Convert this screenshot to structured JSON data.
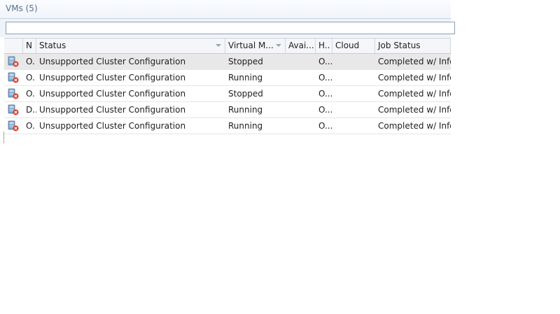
{
  "panel": {
    "title": "VMs (5)",
    "filter": {
      "value": "",
      "placeholder": ""
    }
  },
  "grid": {
    "columns": [
      {
        "key": "icon",
        "label": ""
      },
      {
        "key": "name",
        "label": "N"
      },
      {
        "key": "status",
        "label": "Status"
      },
      {
        "key": "vm",
        "label": "Virtual M..."
      },
      {
        "key": "avail",
        "label": "Avai..."
      },
      {
        "key": "host",
        "label": "H.."
      },
      {
        "key": "cloud",
        "label": "Cloud"
      },
      {
        "key": "job",
        "label": "Job Status"
      }
    ],
    "rows": [
      {
        "icon": "vm-error-icon",
        "name": "O.",
        "status": "Unsupported Cluster Configuration",
        "vm": "Stopped",
        "avail": "",
        "host": "O...",
        "cloud": "",
        "job": "Completed w/ Info",
        "selected": true
      },
      {
        "icon": "vm-error-icon",
        "name": "O.",
        "status": "Unsupported Cluster Configuration",
        "vm": "Running",
        "avail": "",
        "host": "O...",
        "cloud": "",
        "job": "Completed w/ Info",
        "selected": false
      },
      {
        "icon": "vm-error-icon",
        "name": "O.",
        "status": "Unsupported Cluster Configuration",
        "vm": "Stopped",
        "avail": "",
        "host": "O...",
        "cloud": "",
        "job": "Completed w/ Info",
        "selected": false
      },
      {
        "icon": "vm-error-icon",
        "name": "D..",
        "status": "Unsupported Cluster Configuration",
        "vm": "Running",
        "avail": "",
        "host": "O...",
        "cloud": "",
        "job": "Completed w/ Info",
        "selected": false
      },
      {
        "icon": "vm-error-icon",
        "name": "O.",
        "status": "Unsupported Cluster Configuration",
        "vm": "Running",
        "avail": "",
        "host": "O...",
        "cloud": "",
        "job": "Completed w/ Info",
        "selected": false
      }
    ]
  },
  "colors": {
    "title_text": "#5a6f8e",
    "header_bg": "#f4f6f9",
    "selected_row_bg": "#e8e8e8",
    "error_mark": "#d93a2b"
  }
}
